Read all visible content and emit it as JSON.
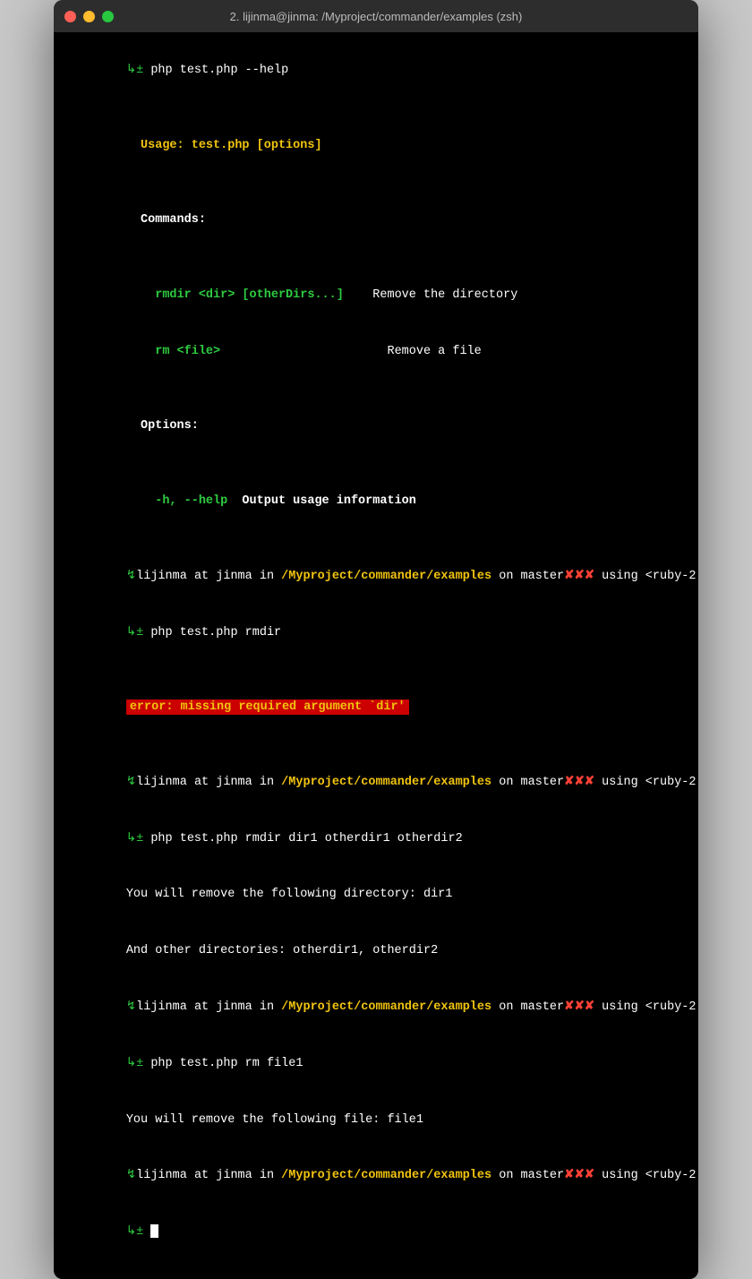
{
  "window": {
    "title": "2. lijinma@jinma: /Myproject/commander/examples (zsh)"
  },
  "terminal": {
    "lines": [
      {
        "type": "prompt-cmd",
        "prompt": "↳± ",
        "cmd": "php test.php --help"
      },
      {
        "type": "blank"
      },
      {
        "type": "help-usage"
      },
      {
        "type": "blank"
      },
      {
        "type": "help-commands-header"
      },
      {
        "type": "blank"
      },
      {
        "type": "help-command-1"
      },
      {
        "type": "help-command-2"
      },
      {
        "type": "blank"
      },
      {
        "type": "help-options-header"
      },
      {
        "type": "blank"
      },
      {
        "type": "help-option-1"
      },
      {
        "type": "blank"
      },
      {
        "type": "prompt-line"
      },
      {
        "type": "prompt-cmd-2",
        "cmd": "php test.php rmdir"
      },
      {
        "type": "blank"
      },
      {
        "type": "error-line"
      },
      {
        "type": "blank"
      },
      {
        "type": "prompt-line"
      },
      {
        "type": "prompt-cmd-3",
        "cmd": "php test.php rmdir dir1 otherdir1 otherdir2"
      },
      {
        "type": "output-1"
      },
      {
        "type": "output-2"
      },
      {
        "type": "prompt-line"
      },
      {
        "type": "prompt-cmd-4",
        "cmd": "php test.php rm file1"
      },
      {
        "type": "output-3"
      },
      {
        "type": "prompt-line"
      },
      {
        "type": "cursor-line"
      }
    ]
  }
}
